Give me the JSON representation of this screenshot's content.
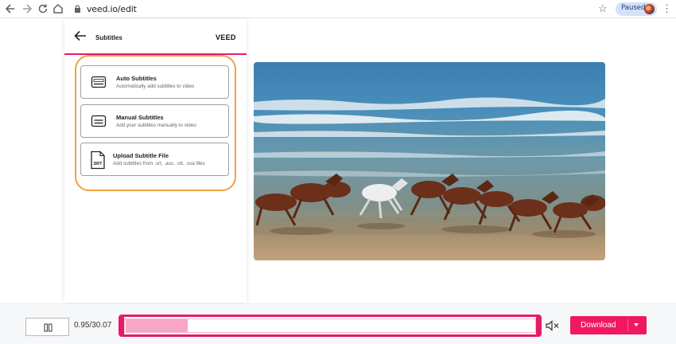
{
  "browser": {
    "url": "veed.io/edit",
    "profile_status": "Paused"
  },
  "panel": {
    "title": "Subtitles",
    "brand": "VEED",
    "options": [
      {
        "title": "Auto Subtitles",
        "subtitle": "Automatically add subtitles to video",
        "icon": "auto-subtitles-icon"
      },
      {
        "title": "Manual Subtitles",
        "subtitle": "Add your subtitles manually to video",
        "icon": "manual-subtitles-icon"
      },
      {
        "title": "Upload Subtitle File",
        "subtitle": "Add subtitles from .srt, .ass, .vtt, .ssa files",
        "icon": "srt-file-icon",
        "icon_text": "SRT"
      }
    ]
  },
  "player": {
    "time": "0.95/30.07",
    "progress_fraction": 0.0316,
    "download_label": "Download"
  },
  "colors": {
    "accent": "#e41b6b",
    "highlight": "#f0a040",
    "download": "#f1185f"
  }
}
